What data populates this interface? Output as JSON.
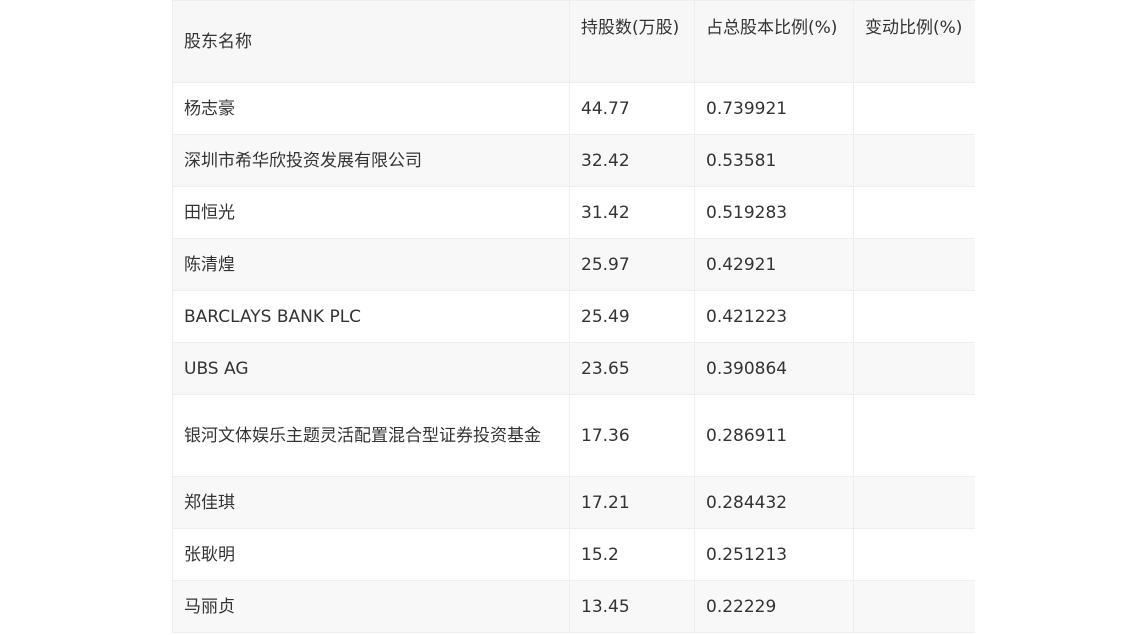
{
  "table": {
    "headers": [
      "股东名称",
      "持股数(万股)",
      "占总股本比例(%)",
      "变动比例(%)"
    ],
    "rows": [
      {
        "name": "杨志豪",
        "shares": "44.77",
        "ratio": "0.739921",
        "change": ""
      },
      {
        "name": "深圳市希华欣投资发展有限公司",
        "shares": "32.42",
        "ratio": "0.53581",
        "change": ""
      },
      {
        "name": "田恒光",
        "shares": "31.42",
        "ratio": "0.519283",
        "change": ""
      },
      {
        "name": "陈清煌",
        "shares": "25.97",
        "ratio": "0.42921",
        "change": ""
      },
      {
        "name": "BARCLAYS BANK PLC",
        "shares": "25.49",
        "ratio": "0.421223",
        "change": ""
      },
      {
        "name": "UBS AG",
        "shares": "23.65",
        "ratio": "0.390864",
        "change": ""
      },
      {
        "name": "银河文体娱乐主题灵活配置混合型证券投资基金",
        "shares": "17.36",
        "ratio": "0.286911",
        "change": ""
      },
      {
        "name": "郑佳琪",
        "shares": "17.21",
        "ratio": "0.284432",
        "change": ""
      },
      {
        "name": "张耿明",
        "shares": "15.2",
        "ratio": "0.251213",
        "change": ""
      },
      {
        "name": "马丽贞",
        "shares": "13.45",
        "ratio": "0.22229",
        "change": ""
      }
    ]
  }
}
